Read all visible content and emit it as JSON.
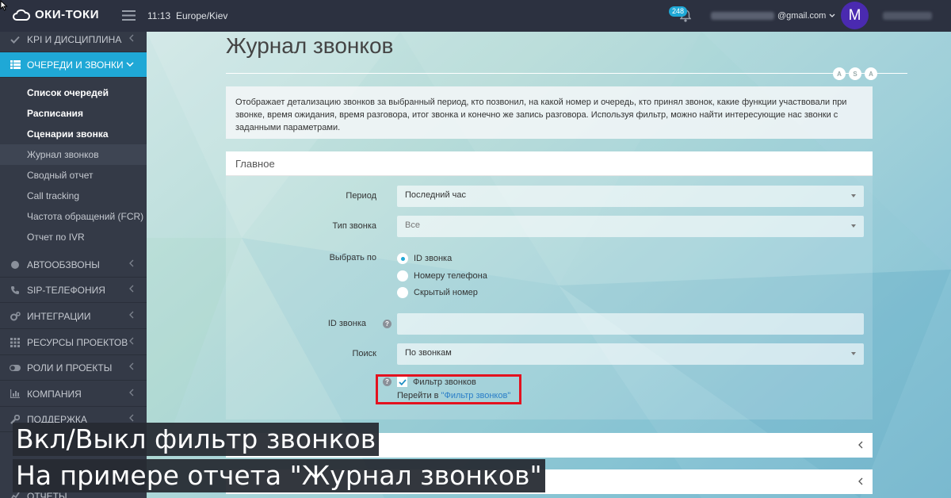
{
  "app": {
    "name": "ОКИ-ТОКИ"
  },
  "topbar": {
    "time": "11:13",
    "timezone": "Europe/Kiev",
    "notifications": "248",
    "email_domain": "@gmail.com",
    "avatar_letter": "M"
  },
  "sidebar": {
    "items": [
      {
        "label": "KPI И ДИСЦИПЛИНА",
        "icon": "check-icon"
      },
      {
        "label": "ОЧЕРЕДИ И ЗВОНКИ",
        "icon": "list-icon",
        "active": true
      },
      {
        "label": "АВТООБЗВОНЫ",
        "icon": "clock-icon"
      },
      {
        "label": "SIP-ТЕЛЕФОНИЯ",
        "icon": "phone-icon"
      },
      {
        "label": "ИНТЕГРАЦИИ",
        "icon": "gears-icon"
      },
      {
        "label": "РЕСУРСЫ ПРОЕКТОВ",
        "icon": "grid-icon"
      },
      {
        "label": "РОЛИ И ПРОЕКТЫ",
        "icon": "toggle-icon"
      },
      {
        "label": "КОМПАНИЯ",
        "icon": "bar-chart-icon"
      },
      {
        "label": "ПОДДЕРЖКА",
        "icon": "wrench-icon"
      },
      {
        "label": "ОТЧЕТЫ",
        "icon": "chart-icon"
      }
    ],
    "subitems": [
      "Список очередей",
      "Расписания",
      "Сценарии звонка",
      "Журнал звонков",
      "Сводный отчет",
      "Call tracking",
      "Частота обращений (FCR)",
      "Отчет по IVR"
    ]
  },
  "page": {
    "title": "Журнал звонков",
    "controls": [
      "A",
      "S",
      "A"
    ],
    "description": "Отображает детализацию звонков за выбранный период, кто позвонил, на какой номер и очередь, кто принял звонок, какие функции участвовали при звонке, время ожидания, время разговора, итог звонка и конечно же запись разговора. Используя фильтр, можно найти интересующие нас звонки с заданными параметрами."
  },
  "form": {
    "section_title": "Главное",
    "period_label": "Период",
    "period_value": "Последний час",
    "call_type_label": "Тип звонка",
    "call_type_value": "Все",
    "select_by_label": "Выбрать по",
    "select_by_options": [
      "ID звонка",
      "Номеру телефона",
      "Скрытый номер"
    ],
    "call_id_label": "ID звонка",
    "search_label": "Поиск",
    "search_value": "По звонкам",
    "filter_label": "Фильтр звонков",
    "goto_text": "Перейти в ",
    "goto_link": "\"Фильтр звонков\""
  },
  "captions": [
    "Вкл/Выкл фильтр звонков",
    "На примере отчета \"Журнал звонков\""
  ]
}
